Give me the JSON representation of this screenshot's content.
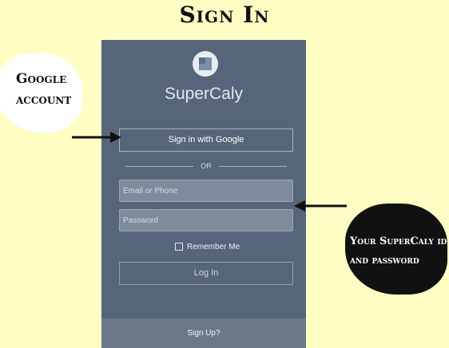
{
  "page": {
    "title": "Sign In"
  },
  "app": {
    "name": "SuperCaly",
    "google_button_label": "Sign in with Google",
    "or_label": "OR",
    "email_placeholder": "Email or Phone",
    "password_placeholder": "Password",
    "remember_label": "Remember Me",
    "login_label": "Log In",
    "signup_label": "Sign Up?"
  },
  "annotations": {
    "google_callout_lines": [
      "Google",
      "account"
    ],
    "supercaly_callout_lines": [
      "Your SuperCaly id",
      "and password"
    ]
  },
  "colors": {
    "background": "#fefec4",
    "panel": "#56657a",
    "signup_bar": "#6b7889"
  }
}
